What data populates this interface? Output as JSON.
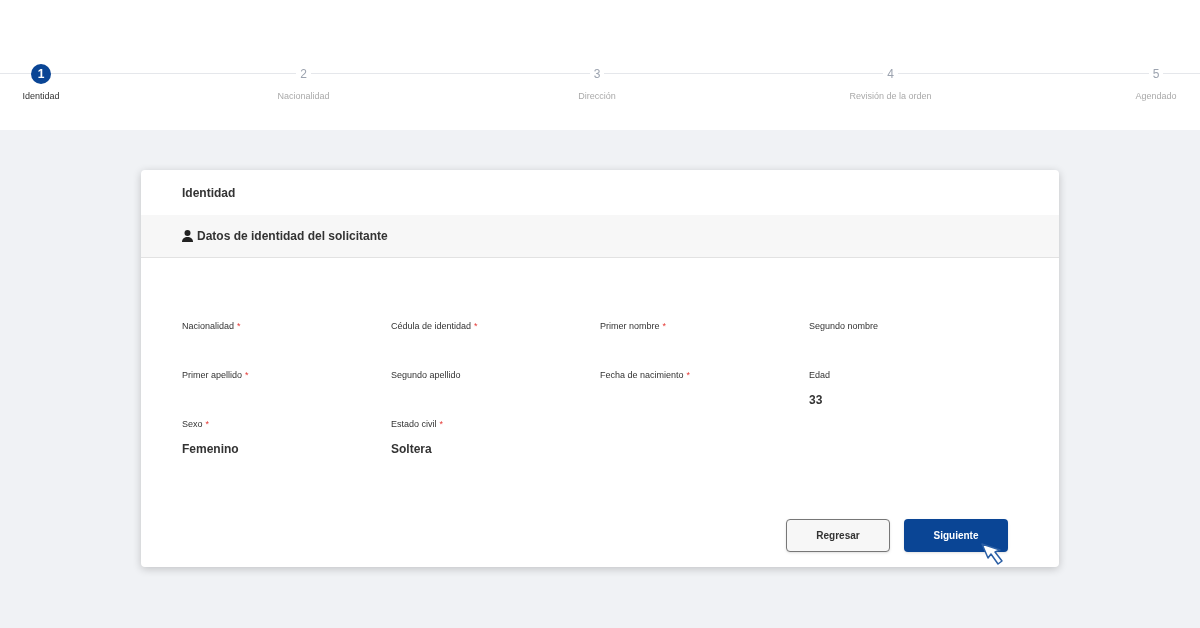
{
  "stepper": [
    {
      "number": "1",
      "label": "Identidad",
      "selected": true
    },
    {
      "number": "2",
      "label": "Nacionalidad",
      "selected": false
    },
    {
      "number": "3",
      "label": "Dirección",
      "selected": false
    },
    {
      "number": "4",
      "label": "Revisión de la orden",
      "selected": false
    },
    {
      "number": "5",
      "label": "Agendado",
      "selected": false
    }
  ],
  "card": {
    "title": "Identidad",
    "section_title": "Datos de identidad del solicitante",
    "fields": [
      {
        "label": "Nacionalidad",
        "required": true
      },
      {
        "label": "Cédula de identidad",
        "required": true
      },
      {
        "label": "Primer nombre",
        "required": true
      },
      {
        "label": "Segundo nombre",
        "required": false
      },
      {
        "label": "Primer apellido",
        "required": true
      },
      {
        "label": "Segundo apellido",
        "required": false
      },
      {
        "label": "Fecha de nacimiento",
        "required": true
      },
      {
        "label": "Edad",
        "required": false,
        "value": "33"
      },
      {
        "label": "Sexo",
        "required": true,
        "value": "Femenino"
      },
      {
        "label": "Estado civil",
        "required": true,
        "value": "Soltera"
      }
    ],
    "required_mark": "*",
    "buttons": [
      {
        "label": "Regresar",
        "kind": "secondary"
      },
      {
        "label": "Siguiente",
        "kind": "primary"
      }
    ]
  }
}
